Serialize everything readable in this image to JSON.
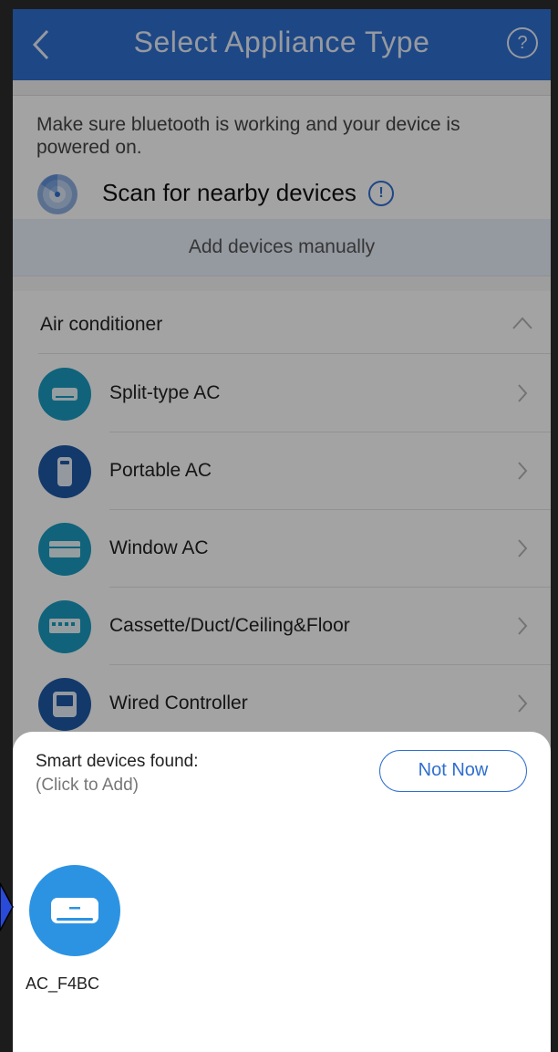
{
  "header": {
    "title": "Select Appliance Type",
    "back_icon": "chevron-left-icon",
    "help_icon": "help-circle-icon",
    "help_glyph": "?",
    "color": "#2f6fd0"
  },
  "scan": {
    "note": "Make sure bluetooth is working and your device is powered on.",
    "label": "Scan for nearby devices",
    "info_glyph": "!",
    "manual_label": "Add devices manually"
  },
  "category": {
    "label": "Air conditioner",
    "items": [
      {
        "label": "Split-type AC",
        "icon": "split-ac-icon",
        "color": "#1a9bc0"
      },
      {
        "label": "Portable AC",
        "icon": "portable-ac-icon",
        "color": "#1f5aa8"
      },
      {
        "label": "Window AC",
        "icon": "window-ac-icon",
        "color": "#1a9bc0"
      },
      {
        "label": "Cassette/Duct/Ceiling&Floor",
        "icon": "cassette-ac-icon",
        "color": "#1a9bc0"
      },
      {
        "label": "Wired Controller",
        "icon": "wired-controller-icon",
        "color": "#1f5aa8"
      }
    ]
  },
  "sheet": {
    "title": "Smart devices found:",
    "subtitle": "(Click to Add)",
    "not_now": "Not Now",
    "devices": [
      {
        "label": "AC_F4BC",
        "icon": "air-conditioner-icon",
        "color": "#2c93e3"
      }
    ]
  }
}
